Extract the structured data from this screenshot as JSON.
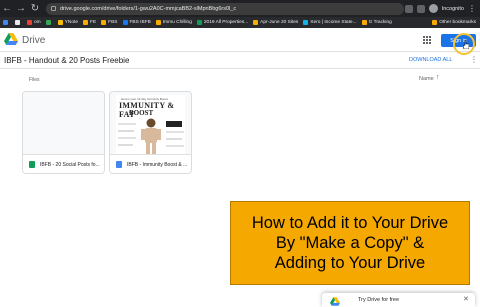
{
  "browser": {
    "url": "drive.google.com/drive/folders/1-gwu2A0C-mmjcaBB2-slMpnBbg6rs0l_c",
    "profile_label": "Incognito",
    "bookmarks": [
      {
        "label": "",
        "color": "#4285f4"
      },
      {
        "label": "",
        "color": "#e8eaed"
      },
      {
        "label": "om",
        "color": "#ea4335"
      },
      {
        "label": "",
        "color": "#34a853"
      },
      {
        "label": "YNote",
        "color": "#fbbc04"
      },
      {
        "label": "FE",
        "color": "#f9ab00"
      },
      {
        "label": "FBS",
        "color": "#f9ab00"
      },
      {
        "label": "FBS IBFB",
        "color": "#1877f2"
      },
      {
        "label": "Immu Chilling",
        "color": "#f9ab00"
      },
      {
        "label": "2019 All Properties...",
        "color": "#0f9d58"
      },
      {
        "label": "Apr-June 20 Sites",
        "color": "#f9ab00"
      },
      {
        "label": "Xero | Income State...",
        "color": "#13b5ea"
      },
      {
        "label": "G Tracking",
        "color": "#f9ab00"
      }
    ],
    "other_bookmarks": "Other bookmarks"
  },
  "header": {
    "app_name": "Drive",
    "signin_label": "Sign in"
  },
  "folder": {
    "title": "IBFB - Handout & 20 Posts Freebie",
    "download_all": "DOWNLOAD ALL",
    "files_label": "Files",
    "sort_label": "Name"
  },
  "files": [
    {
      "name": "IBFB - 20 Social Posts fo...",
      "type_color": "#0f9d58"
    },
    {
      "name": "IBFB - Immunity Boost & ...",
      "type_color": "#4285f4"
    }
  ],
  "poster": {
    "top_line": "Here's your 14 day Immunity Boost",
    "head": "IMMUNITY & FAT",
    "sub": "BOOST"
  },
  "callout": {
    "line1": "How to Add it to Your Drive",
    "line2": "By \"Make a Copy\" &",
    "line3": "Adding to Your Drive"
  },
  "popup": {
    "text": "Try Drive for free"
  }
}
